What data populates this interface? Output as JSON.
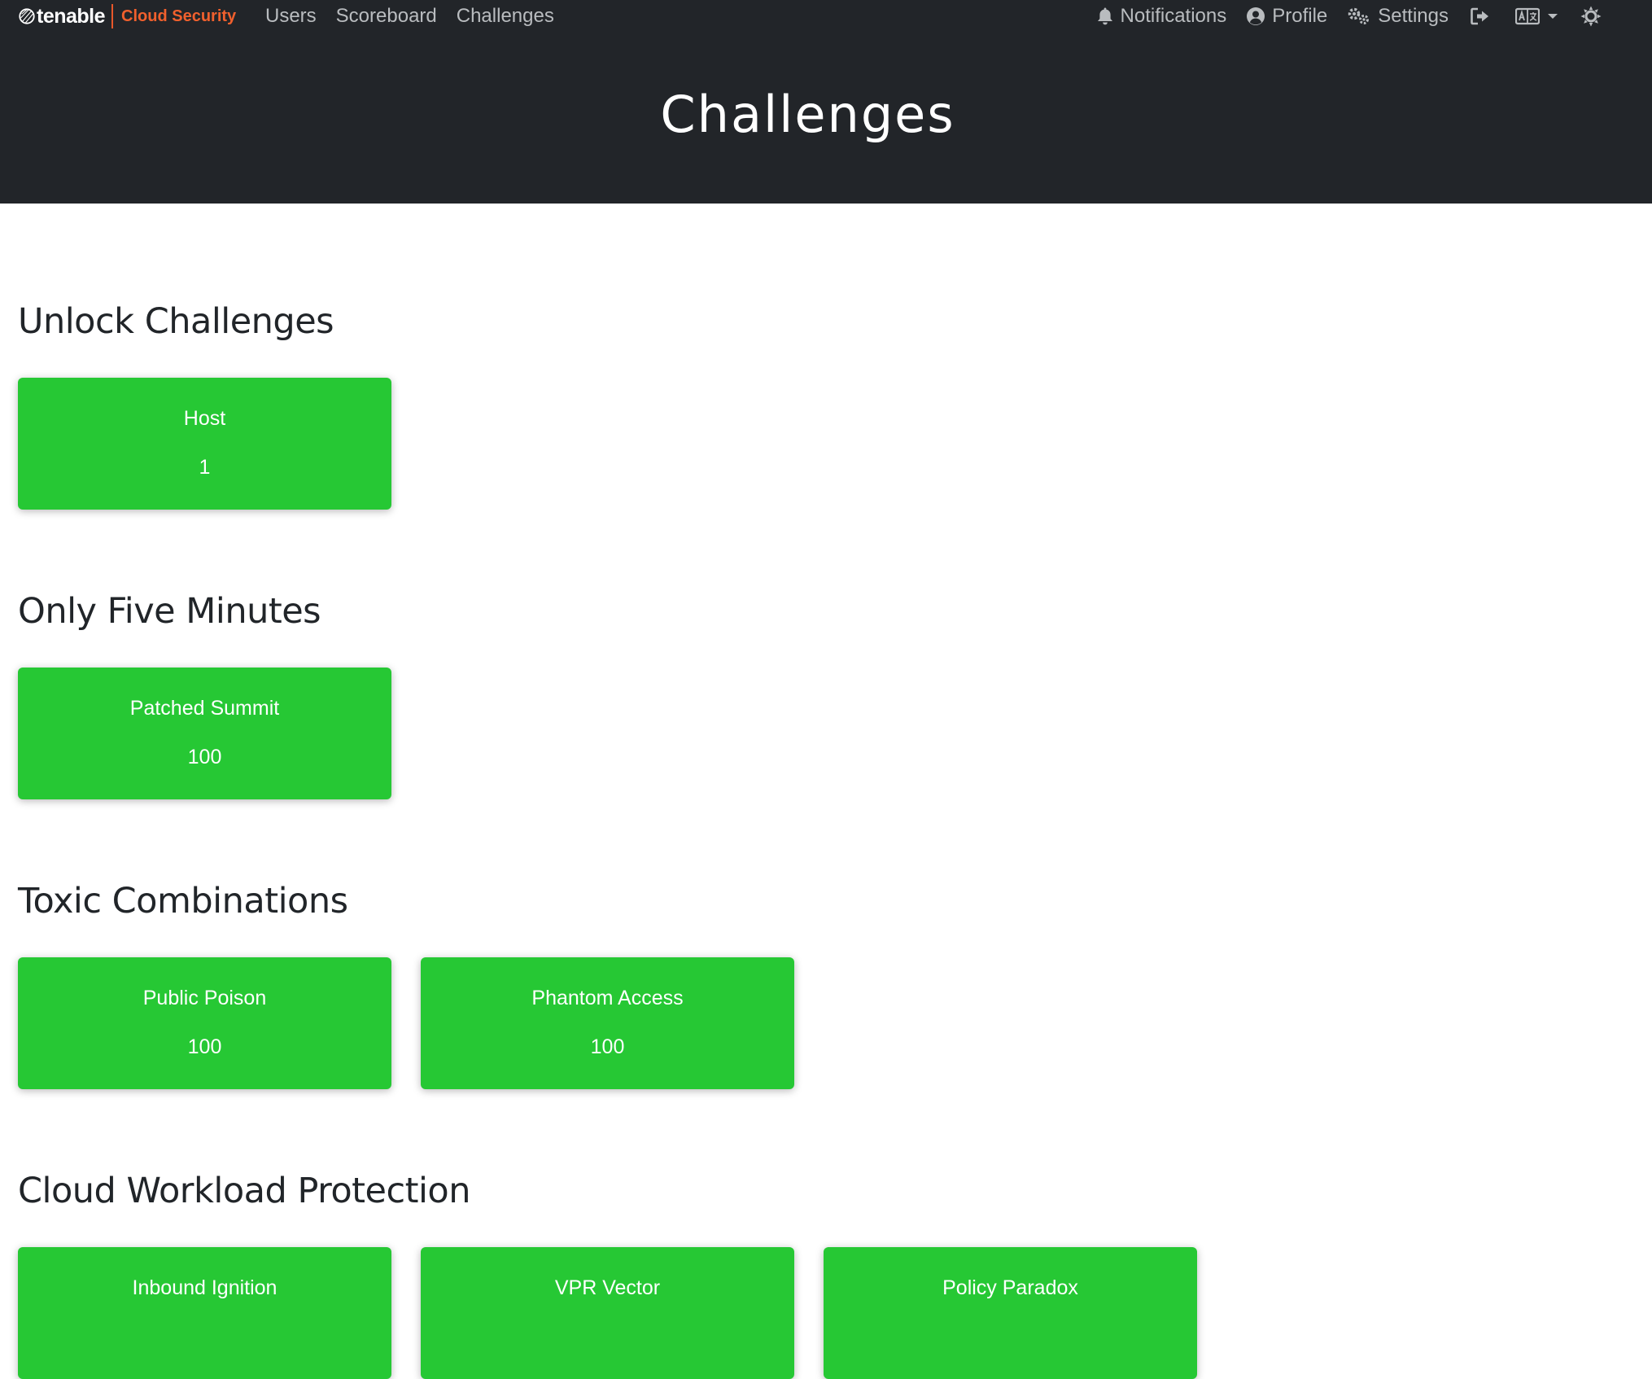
{
  "brand": {
    "name": "tenable",
    "product": "Cloud Security"
  },
  "nav": {
    "links": [
      "Users",
      "Scoreboard",
      "Challenges"
    ],
    "right": {
      "notifications": "Notifications",
      "profile": "Profile",
      "settings": "Settings"
    },
    "icons": {
      "notifications": "bell-icon",
      "profile": "user-circle-icon",
      "settings": "gears-icon",
      "logout": "sign-out-icon",
      "language": "language-icon",
      "theme": "sun-icon"
    }
  },
  "page": {
    "title": "Challenges"
  },
  "colors": {
    "header_bg": "#222529",
    "card_bg": "#26c834",
    "brand_orange": "#f1602d",
    "nav_text": "#b9bcbf"
  },
  "categories": [
    {
      "title": "Unlock Challenges",
      "challenges": [
        {
          "name": "Host",
          "value": "1"
        }
      ]
    },
    {
      "title": "Only Five Minutes",
      "challenges": [
        {
          "name": "Patched Summit",
          "value": "100"
        }
      ]
    },
    {
      "title": "Toxic Combinations",
      "challenges": [
        {
          "name": "Public Poison",
          "value": "100"
        },
        {
          "name": "Phantom Access",
          "value": "100"
        }
      ]
    },
    {
      "title": "Cloud Workload Protection",
      "challenges": [
        {
          "name": "Inbound Ignition",
          "value": ""
        },
        {
          "name": "VPR Vector",
          "value": ""
        },
        {
          "name": "Policy Paradox",
          "value": ""
        }
      ]
    }
  ]
}
